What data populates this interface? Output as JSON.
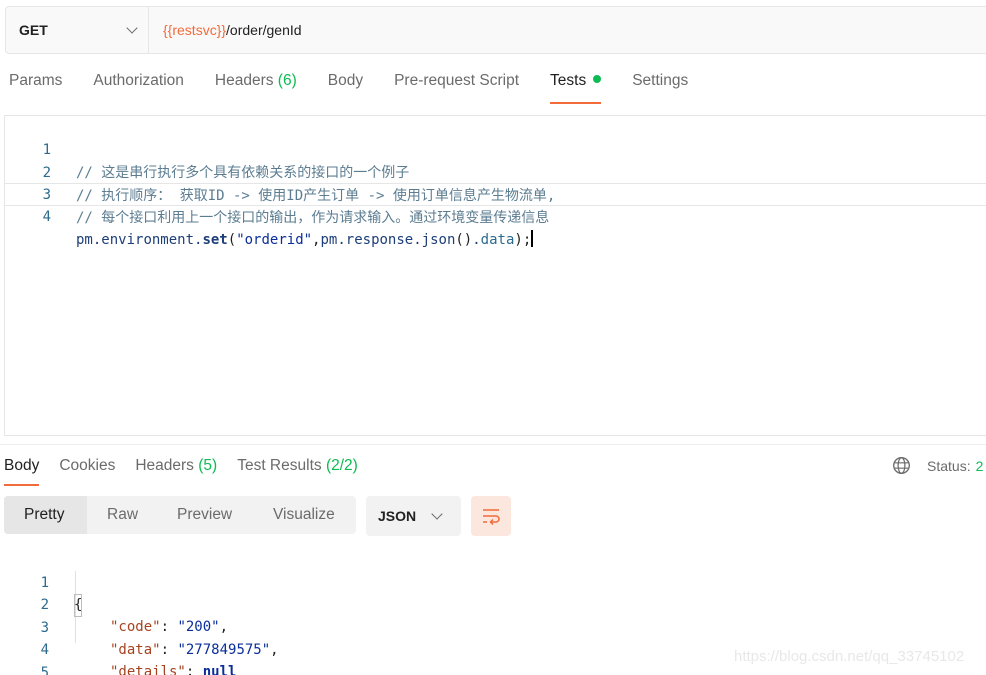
{
  "request": {
    "method": "GET",
    "url_var": "{{restsvc}}",
    "url_path": "/order/genId"
  },
  "request_tabs": {
    "params": "Params",
    "authorization": "Authorization",
    "headers": "Headers",
    "headers_count": "(6)",
    "body": "Body",
    "pre_request": "Pre-request Script",
    "tests": "Tests",
    "settings": "Settings"
  },
  "editor": {
    "line_numbers": [
      "1",
      "2",
      "3",
      "4"
    ],
    "comment1": "// 这是串行执行多个具有依赖关系的接口的一个例子",
    "comment2": "// 执行顺序： 获取ID -> 使用ID产生订单 -> 使用订单信息产生物流单,",
    "comment3": "// 每个接口利用上一个接口的输出，作为请求输入。通过环境变量传递信息",
    "tok_pm1": "pm",
    "tok_dot1": ".",
    "tok_env": "environment",
    "tok_dot2": ".",
    "tok_set": "set",
    "tok_open": "(",
    "tok_str": "\"orderid\"",
    "tok_comma": ",",
    "tok_pm2": "pm",
    "tok_dot3": ".",
    "tok_response": "response",
    "tok_dot4": ".",
    "tok_json": "json",
    "tok_parens": "()",
    "tok_dot5": ".",
    "tok_data": "data",
    "tok_close": ");"
  },
  "response_tabs": {
    "body": "Body",
    "cookies": "Cookies",
    "headers": "Headers",
    "headers_count": "(5)",
    "test_results": "Test Results",
    "test_results_count": "(2/2)",
    "status_label": "Status:",
    "status_value": "2"
  },
  "view_modes": [
    "Pretty",
    "Raw",
    "Preview",
    "Visualize"
  ],
  "format": "JSON",
  "response_body": {
    "line_numbers": [
      "1",
      "2",
      "3",
      "4",
      "5"
    ],
    "open_brace": "{",
    "close_brace": "}",
    "key_code": "\"code\"",
    "val_code": "\"200\"",
    "key_data": "\"data\"",
    "val_data": "\"277849575\"",
    "key_details": "\"details\"",
    "val_details": "null",
    "colon": ": ",
    "comma": ","
  },
  "watermark": "https://blog.csdn.net/qq_33745102",
  "colors": {
    "accent": "#f26b3a",
    "success": "#0cbb52"
  }
}
